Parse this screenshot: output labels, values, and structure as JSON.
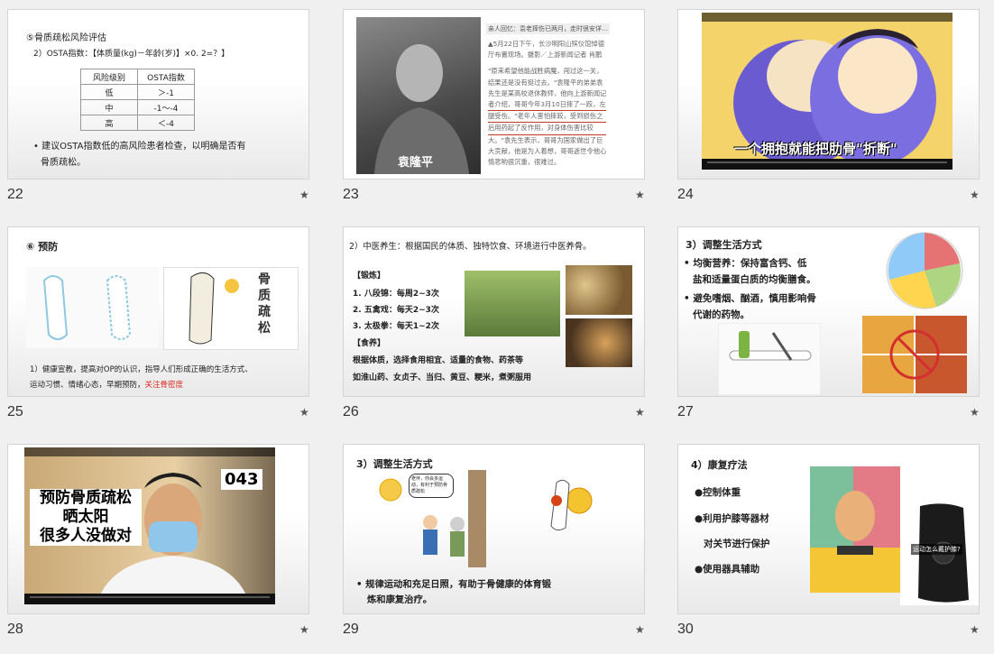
{
  "slides": [
    {
      "number": "22",
      "heading": "⑤骨质疏松风险评估",
      "formula": "2）OSTA指数：【体质量(kg)－年龄(岁)】×0. 2=？】",
      "table": {
        "headers": [
          "风险级别",
          "OSTA指数"
        ],
        "rows": [
          [
            "低",
            "＞-1"
          ],
          [
            "中",
            "-1～-4"
          ],
          [
            "高",
            "＜-4"
          ]
        ]
      },
      "bullet_1": "• 建议OSTA指数低的高风险患者检查，以明确是否有",
      "bullet_2": "骨质疏松。"
    },
    {
      "number": "23",
      "photo_caption": "袁隆平",
      "header": "亲人回忆：袁老摔伤已两月，走时很安详…",
      "lines": [
        "▲5月22日下午，长沙明阳山殡仪馆悼德",
        "厅布置现场。摄影／上游新闻记者 肖鹏",
        "",
        "\"原来希望他能战胜病魔，闯过这一关，",
        "结果还是没有挺过去。\"袁隆平的弟弟袁",
        "先生是某高校退休教师，他向上游新闻记",
        "者介绍，哥哥今年3月10日摔了一跤，左",
        "腿受伤。\"老年人害怕摔跤，受到损伤之",
        "后用药起了反作用，对身体伤害比较",
        "大。\"袁先生表示，哥哥为国家做出了巨",
        "大贡献，他是为人着想，哥哥逝世令他心",
        "情悲哟很沉重，很难过。"
      ]
    },
    {
      "number": "24",
      "subtitle": "一个拥抱就能把肋骨\"折断\""
    },
    {
      "number": "25",
      "heading": "⑥ 预防",
      "book_title": [
        "骨",
        "质",
        "疏",
        "松"
      ],
      "text_1": "1）健康宣教，提高对OP的认识，指导人们形成正确的生活方式、",
      "text_2a": "运动习惯、情绪心态，早期预防，",
      "text_2b": "关注骨密度"
    },
    {
      "number": "26",
      "heading": "2）中医养生：根据国民的体质、独特饮食、环境进行中医养骨。",
      "exercise_title": "【锻炼】",
      "exercises": [
        "1.  八段锦：每周2~3次",
        "2.  五禽戏：每天2~3次",
        "3.  太极拳：每天1~2次"
      ],
      "diet_title": "【食养】",
      "diet_1": "根据体质，选择食用相宜、适量的食物、药茶等",
      "diet_2": "如淮山药、女贞子、当归、黄豆、粳米，煮粥服用"
    },
    {
      "number": "27",
      "heading": "3）调整生活方式",
      "b1a": "• 均衡营养：保持富含钙、低",
      "b1b": "盐和适量蛋白质的均衡膳食。",
      "b2a": "• 避免嗜烟、酗酒，慎用影响骨",
      "b2b": "代谢的药物。"
    },
    {
      "number": "28",
      "overlay": [
        "预防骨质疏松",
        "晒太阳",
        "很多人没做对"
      ],
      "badge": "043"
    },
    {
      "number": "29",
      "heading": "3）调整生活方式",
      "bubble": "老伴，你会多运动，有利于预防骨质疏松",
      "b1a": "•  规律运动和充足日照，有助于骨健康的体育锻",
      "b1b": "炼和康复治疗。"
    },
    {
      "number": "30",
      "heading": "4）康复疗法",
      "items": [
        "●控制体重",
        "●利用护膝等器材",
        "对关节进行保护",
        "●使用器具辅助"
      ],
      "photo_label": "运动怎么戴护膝?"
    }
  ],
  "icons": {
    "star": "★"
  },
  "colors": {
    "accent_red": "#d9261c",
    "underline": "#c0392b"
  }
}
